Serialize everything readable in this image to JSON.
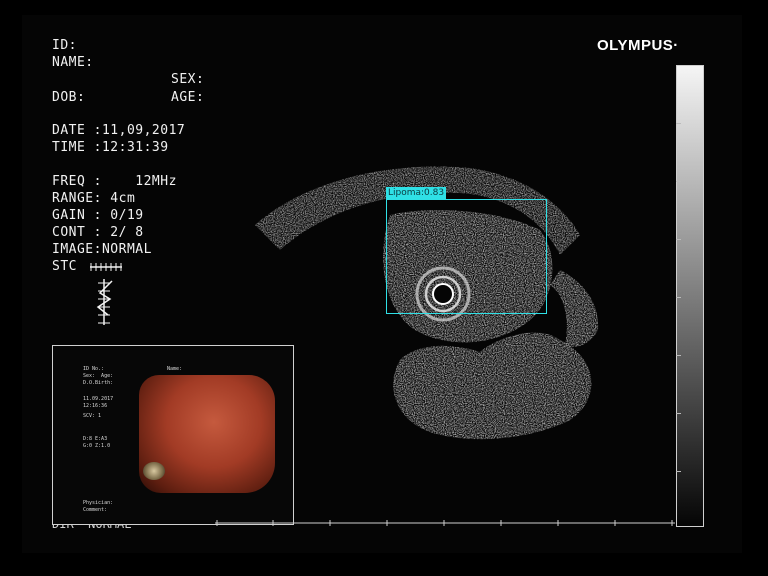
{
  "brand": {
    "name": "OLYMPUS·"
  },
  "patient": {
    "id_label": "ID:",
    "name_label": "NAME:",
    "sex_label": "SEX:",
    "dob_label": "DOB:",
    "age_label": "AGE:"
  },
  "datetime": {
    "date": "DATE :11,09,2017",
    "time": "TIME :12:31:39"
  },
  "settings": {
    "freq": "FREQ :    12MHz",
    "range": "RANGE: 4cm",
    "gain": "GAIN : 0/19",
    "cont": "CONT : 2/ 8",
    "image": "IMAGE:NORMAL",
    "stc": "STC"
  },
  "detection": {
    "label": "Lipoma:0.83",
    "color": "#2fe0e6"
  },
  "pip": {
    "id_line": "ID No.: ",
    "sex_age": "Sex:  Age:",
    "dob": "D.O.Birth:",
    "name": "Name:",
    "date": "11.09.2017",
    "time": "12:16:36",
    "scv": "SCV: 1",
    "line1": "D:8 E:A3",
    "line2": "G:0 Z:1.0",
    "physician": "Physician:",
    "comment": "Comment:"
  },
  "bottom_text": "DIR  NORMAL",
  "colors": {
    "background": "#000000",
    "overlay_text": "#f2f2f2",
    "endoscopy_tissue": "#a23b25"
  }
}
